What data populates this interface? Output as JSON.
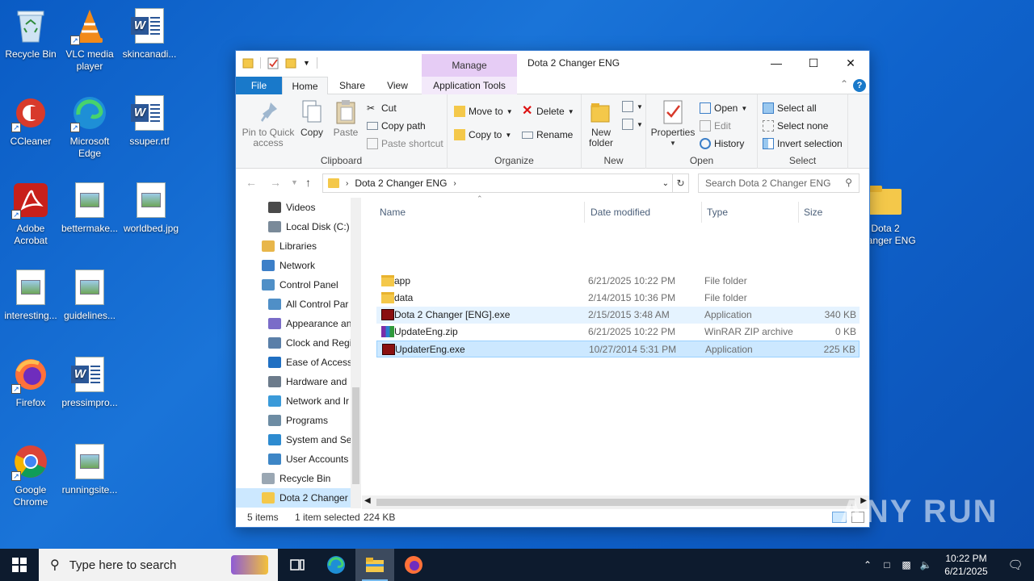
{
  "desktop": {
    "icons": [
      {
        "label": "Recycle Bin",
        "icon": "recycle-bin-icon"
      },
      {
        "label": "VLC media player",
        "icon": "vlc-icon"
      },
      {
        "label": "skincanadi...",
        "icon": "word-doc-icon"
      },
      {
        "label": "CCleaner",
        "icon": "ccleaner-icon"
      },
      {
        "label": "Microsoft Edge",
        "icon": "edge-icon"
      },
      {
        "label": "ssuper.rtf",
        "icon": "word-doc-icon"
      },
      {
        "label": "Adobe Acrobat",
        "icon": "acrobat-icon"
      },
      {
        "label": "bettermake...",
        "icon": "image-file-icon"
      },
      {
        "label": "worldbed.jpg",
        "icon": "image-file-icon"
      },
      {
        "label": "interesting...",
        "icon": "image-file-icon"
      },
      {
        "label": "guidelines...",
        "icon": "image-file-icon"
      },
      {
        "label": "Firefox",
        "icon": "firefox-icon"
      },
      {
        "label": "pressimpro...",
        "icon": "word-doc-icon"
      },
      {
        "label": "Google Chrome",
        "icon": "chrome-icon"
      },
      {
        "label": "runningsite...",
        "icon": "image-file-icon"
      },
      {
        "label": "Dota 2 Changer ENG",
        "icon": "folder-icon"
      }
    ]
  },
  "window": {
    "title": "Dota 2 Changer ENG",
    "manage_tab": "Manage",
    "tabs": {
      "file": "File",
      "home": "Home",
      "share": "Share",
      "view": "View",
      "app_tools": "Application Tools"
    },
    "ribbon": {
      "clipboard": {
        "pin": "Pin to Quick access",
        "copy": "Copy",
        "paste": "Paste",
        "cut": "Cut",
        "copy_path": "Copy path",
        "paste_shortcut": "Paste shortcut",
        "label": "Clipboard"
      },
      "organize": {
        "move_to": "Move to",
        "copy_to": "Copy to",
        "delete": "Delete",
        "rename": "Rename",
        "label": "Organize"
      },
      "new": {
        "new_folder": "New folder",
        "label": "New"
      },
      "open": {
        "properties": "Properties",
        "open": "Open",
        "edit": "Edit",
        "history": "History",
        "label": "Open"
      },
      "select": {
        "select_all": "Select all",
        "select_none": "Select none",
        "invert": "Invert selection",
        "label": "Select"
      }
    },
    "address": {
      "path": "Dota 2 Changer ENG",
      "search_placeholder": "Search Dota 2 Changer ENG"
    },
    "nav": [
      {
        "label": "Videos",
        "color": "#4a4a4a"
      },
      {
        "label": "Local Disk (C:)",
        "color": "#7a8a99"
      },
      {
        "label": "Libraries",
        "color": "#e8b64a"
      },
      {
        "label": "Network",
        "color": "#3c7fc8"
      },
      {
        "label": "Control Panel",
        "color": "#4f8fc7"
      },
      {
        "label": "All Control Par",
        "color": "#4f8fc7"
      },
      {
        "label": "Appearance an",
        "color": "#7a6cc8"
      },
      {
        "label": "Clock and Regi",
        "color": "#5a7fa8"
      },
      {
        "label": "Ease of Access",
        "color": "#1f6fc2"
      },
      {
        "label": "Hardware and",
        "color": "#6c7b8b"
      },
      {
        "label": "Network and Ir",
        "color": "#3a9ad9"
      },
      {
        "label": "Programs",
        "color": "#6d8ca3"
      },
      {
        "label": "System and Se",
        "color": "#2d8bd0"
      },
      {
        "label": "User Accounts",
        "color": "#3d86c6"
      },
      {
        "label": "Recycle Bin",
        "color": "#9aa7b3"
      },
      {
        "label": "Dota 2 Changer",
        "color": "#f4c84a"
      }
    ],
    "columns": {
      "name": "Name",
      "date": "Date modified",
      "type": "Type",
      "size": "Size"
    },
    "files": [
      {
        "name": "app",
        "date": "6/21/2025 10:22 PM",
        "type": "File folder",
        "size": "",
        "icon": "folder-icon"
      },
      {
        "name": "data",
        "date": "2/14/2015 10:36 PM",
        "type": "File folder",
        "size": "",
        "icon": "folder-icon"
      },
      {
        "name": "Dota 2 Changer [ENG].exe",
        "date": "2/15/2015 3:48 AM",
        "type": "Application",
        "size": "340 KB",
        "icon": "exe-icon"
      },
      {
        "name": "UpdateEng.zip",
        "date": "6/21/2025 10:22 PM",
        "type": "WinRAR ZIP archive",
        "size": "0 KB",
        "icon": "winrar-icon"
      },
      {
        "name": "UpdaterEng.exe",
        "date": "10/27/2014 5:31 PM",
        "type": "Application",
        "size": "225 KB",
        "icon": "exe-icon"
      }
    ],
    "status": {
      "items": "5 items",
      "selected": "1 item selected",
      "size": "224 KB"
    }
  },
  "taskbar": {
    "search_placeholder": "Type here to search",
    "time": "10:22 PM",
    "date": "6/21/2025"
  },
  "watermark": "ANY RUN"
}
